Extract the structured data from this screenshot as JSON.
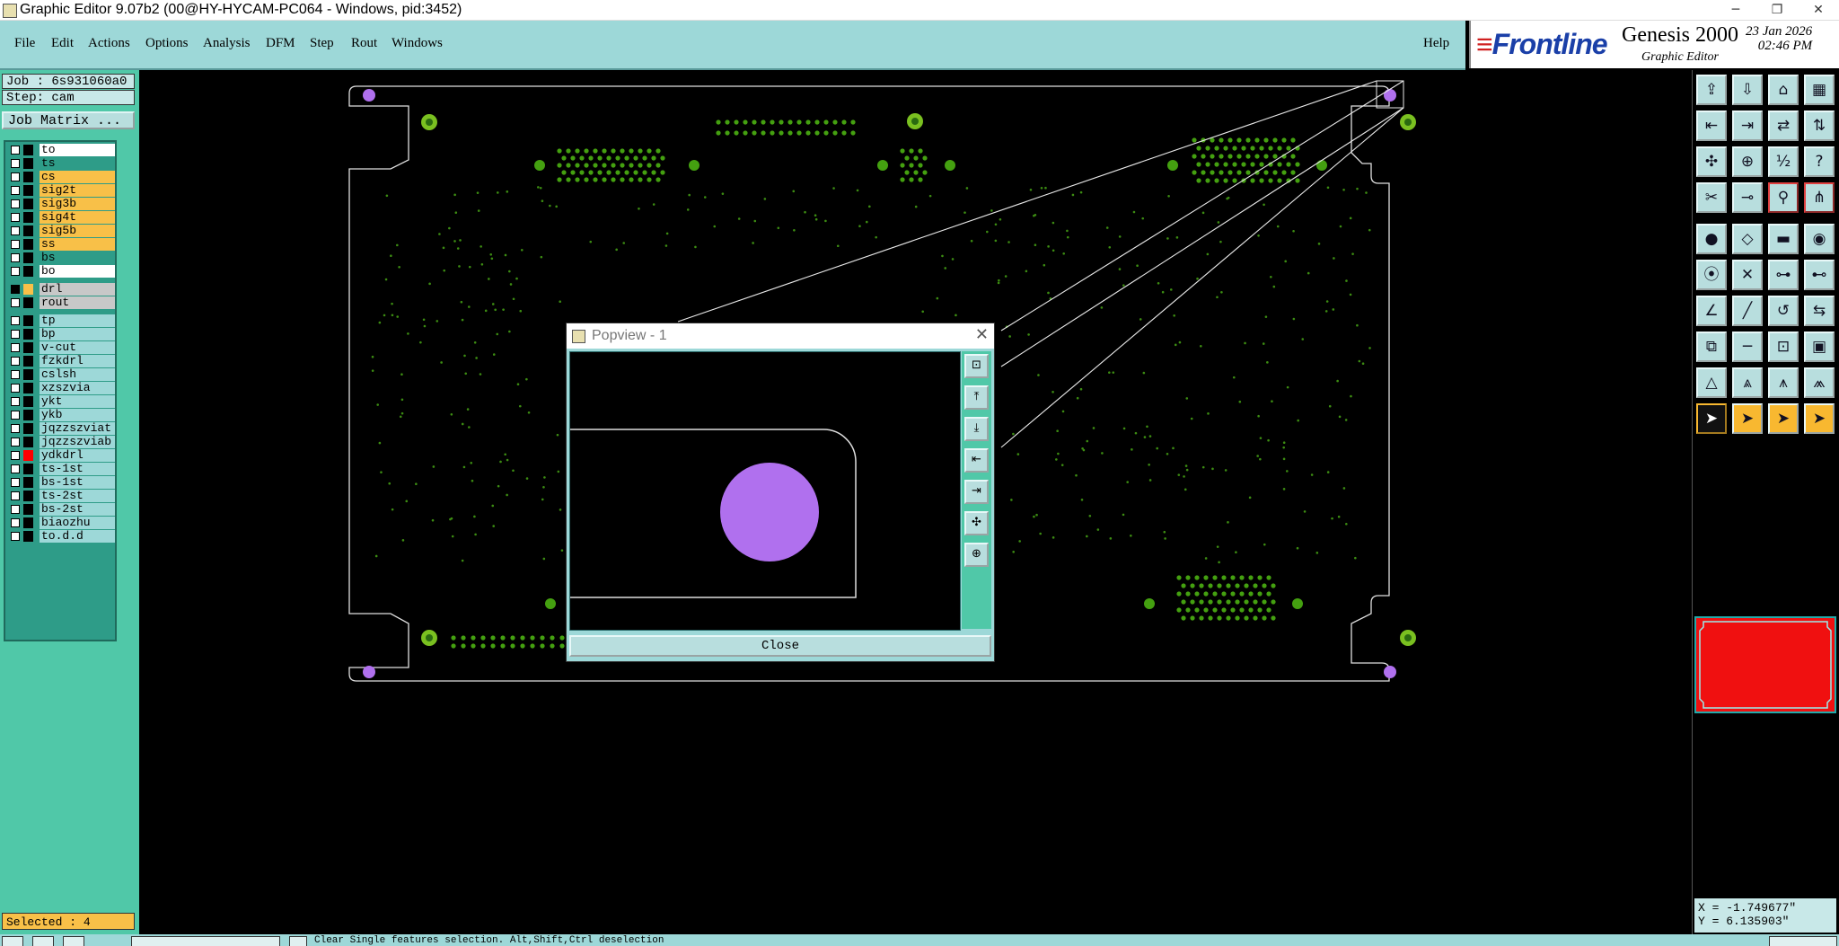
{
  "window": {
    "title": "Graphic Editor 9.07b2 (00@HY-HYCAM-PC064 - Windows, pid:3452)",
    "controls": [
      "minimize",
      "restore",
      "close"
    ]
  },
  "menubar": {
    "items": [
      {
        "label": "File"
      },
      {
        "label": "Edit"
      },
      {
        "label": "Actions"
      },
      {
        "label": "Options"
      },
      {
        "label": "Analysis"
      },
      {
        "label": "DFM"
      },
      {
        "label": "Step"
      },
      {
        "label": "Rout"
      },
      {
        "label": "Windows"
      }
    ],
    "help": "Help"
  },
  "logo": {
    "brand": "Frontline",
    "product": "Genesis 2000",
    "subtitle": "Graphic Editor",
    "date": "23 Jan 2026",
    "time": "02:46 PM"
  },
  "job": {
    "job_line": "Job : 6s931060a0",
    "step_line": "Step: cam",
    "job_matrix_button": "Job Matrix ..."
  },
  "layers": [
    {
      "name": "to",
      "color": "#ffffff"
    },
    {
      "name": "ts",
      "color": "#2e9c88"
    },
    {
      "name": "cs",
      "color": "#f8c048"
    },
    {
      "name": "sig2t",
      "color": "#f8c048"
    },
    {
      "name": "sig3b",
      "color": "#f8c048"
    },
    {
      "name": "sig4t",
      "color": "#f8c048"
    },
    {
      "name": "sig5b",
      "color": "#f8c048"
    },
    {
      "name": "ss",
      "color": "#f8c048"
    },
    {
      "name": "bs",
      "color": "#2e9c88"
    },
    {
      "name": "bo",
      "color": "#ffffff"
    },
    {
      "name": "drl",
      "color": "#c8c8c8",
      "active": true
    },
    {
      "name": "rout",
      "color": "#c8c8c8"
    },
    {
      "name": "tp",
      "color": "#9dd8d8"
    },
    {
      "name": "bp",
      "color": "#9dd8d8"
    },
    {
      "name": "v-cut",
      "color": "#9dd8d8"
    },
    {
      "name": "fzkdrl",
      "color": "#9dd8d8"
    },
    {
      "name": "cslsh",
      "color": "#9dd8d8"
    },
    {
      "name": "xzszvia",
      "color": "#9dd8d8"
    },
    {
      "name": "ykt",
      "color": "#9dd8d8"
    },
    {
      "name": "ykb",
      "color": "#9dd8d8"
    },
    {
      "name": "jqzzszviat",
      "color": "#9dd8d8"
    },
    {
      "name": "jqzzszviab",
      "color": "#9dd8d8"
    },
    {
      "name": "ydkdrl",
      "color": "#9dd8d8",
      "swatch": "#ff0000"
    },
    {
      "name": "ts-1st",
      "color": "#9dd8d8"
    },
    {
      "name": "bs-1st",
      "color": "#9dd8d8"
    },
    {
      "name": "ts-2st",
      "color": "#9dd8d8"
    },
    {
      "name": "bs-2st",
      "color": "#9dd8d8"
    },
    {
      "name": "biaozhu",
      "color": "#9dd8d8"
    },
    {
      "name": "to.d.d",
      "color": "#9dd8d8"
    }
  ],
  "selected": "Selected : 4",
  "popview": {
    "title": "Popview - 1",
    "close_label": "Close",
    "tool_icons": [
      "zoom-home-icon",
      "zoom-in-icon",
      "zoom-out-icon",
      "pan-left-icon",
      "pan-right-icon",
      "zoom-fit-icon",
      "zoom-area-icon"
    ]
  },
  "toolbox": {
    "icons": [
      "open-icon",
      "save-icon",
      "home-icon",
      "window-icon",
      "move-left-icon",
      "move-right-icon",
      "swap-icon",
      "layer-order-icon",
      "zoom-fit-icon",
      "zoom-center-icon",
      "ratio-icon",
      "help-icon",
      "measure-icon",
      "probe-icon",
      "snap-icon",
      "grid-snap-icon",
      "add-pad-icon",
      "add-shape-icon",
      "add-line-icon",
      "add-round-icon",
      "connect-icon",
      "cross-icon",
      "node-icon",
      "node-add-icon",
      "angle-icon",
      "line-edit-icon",
      "rotate-icon",
      "mirror-icon",
      "copy-icon",
      "trim-icon",
      "cut-icon",
      "feature-icon",
      "warn-icon",
      "arrow-up-icon",
      "arrow-limit-icon",
      "arrow-multi-icon",
      "select-pointer-icon",
      "pointer-move-icon",
      "pointer-rotate-icon",
      "pointer-multi-icon"
    ]
  },
  "coords": {
    "x": "X = -1.749677\"",
    "y": "Y = 6.135903\""
  },
  "status": {
    "message": "Clear Single features selection. Alt,Shift,Ctrl deselection"
  },
  "colors": {
    "panel": "#50c8a8",
    "menubar": "#9dd8d8",
    "board_outline": "#e0e0e0",
    "pad_green": "#44a010",
    "drill_purple": "#b070ee",
    "preview_red": "#f01010"
  }
}
